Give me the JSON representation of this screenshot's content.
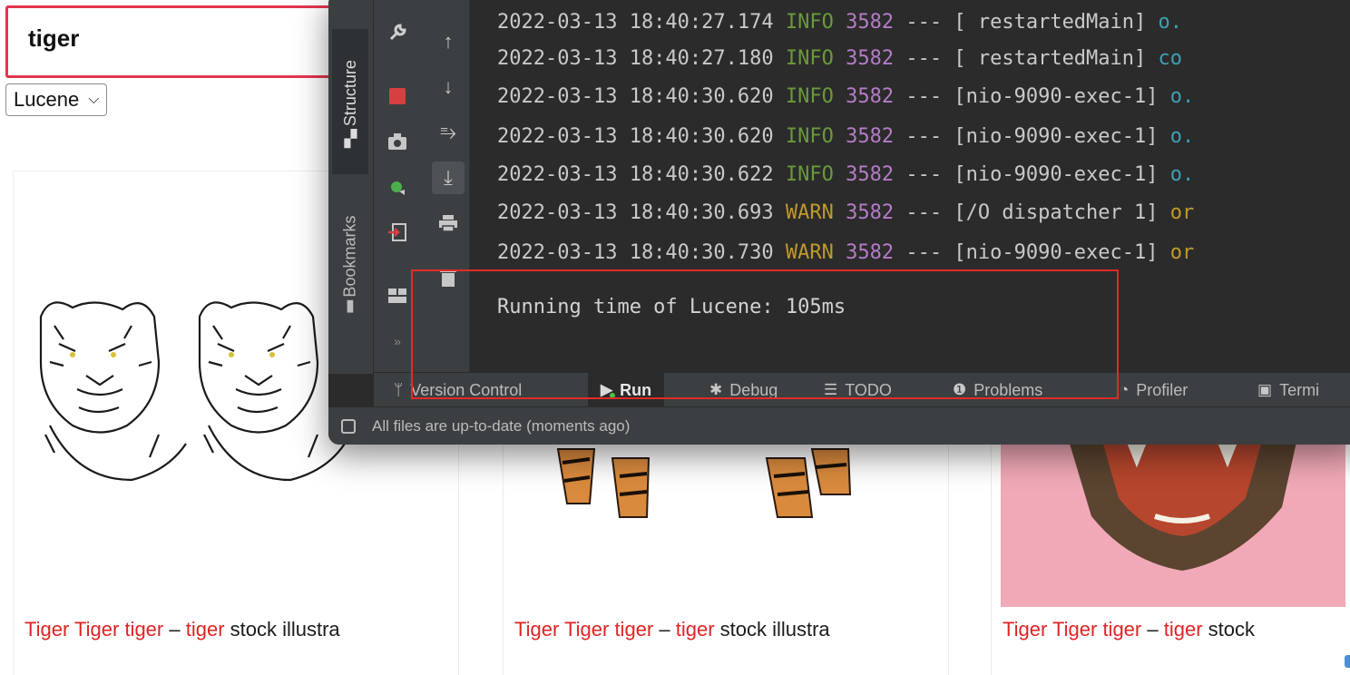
{
  "search": {
    "value": "tiger"
  },
  "engine_select": {
    "selected": "Lucene",
    "caret": "⌵"
  },
  "results": [
    {
      "title_parts": [
        {
          "text": "Tiger Tiger tiger",
          "hl": true
        },
        {
          "text": " – ",
          "hl": false
        },
        {
          "text": "tiger",
          "hl": true
        },
        {
          "text": " stock illustra",
          "hl": false
        }
      ]
    },
    {
      "title_parts": [
        {
          "text": "Tiger Tiger tiger",
          "hl": true
        },
        {
          "text": " – ",
          "hl": false
        },
        {
          "text": "tiger",
          "hl": true
        },
        {
          "text": " stock illustra",
          "hl": false
        }
      ]
    },
    {
      "title_parts": [
        {
          "text": "Tiger Tiger tiger",
          "hl": true
        },
        {
          "text": " – ",
          "hl": false
        },
        {
          "text": "tiger",
          "hl": true
        },
        {
          "text": " stock",
          "hl": false
        }
      ]
    }
  ],
  "ide": {
    "side_tabs": {
      "structure": "Structure",
      "bookmarks": "Bookmarks"
    },
    "log_lines": [
      {
        "ts": "2022-03-13 18:40:27.174",
        "level": "INFO",
        "pid": "3582",
        "sep": "---",
        "thread": "[  restartedMain]",
        "logger": "o."
      },
      {
        "ts": "2022-03-13 18:40:27.180",
        "level": "INFO",
        "pid": "3582",
        "sep": "---",
        "thread": "[  restartedMain]",
        "logger": "co"
      },
      {
        "ts": "2022-03-13 18:40:30.620",
        "level": "INFO",
        "pid": "3582",
        "sep": "---",
        "thread": "[nio-9090-exec-1]",
        "logger": "o."
      },
      {
        "ts": "2022-03-13 18:40:30.620",
        "level": "INFO",
        "pid": "3582",
        "sep": "---",
        "thread": "[nio-9090-exec-1]",
        "logger": "o."
      },
      {
        "ts": "2022-03-13 18:40:30.622",
        "level": "INFO",
        "pid": "3582",
        "sep": "---",
        "thread": "[nio-9090-exec-1]",
        "logger": "o."
      },
      {
        "ts": "2022-03-13 18:40:30.693",
        "level": "WARN",
        "pid": "3582",
        "sep": "---",
        "thread": "[/O dispatcher 1]",
        "logger": "or"
      },
      {
        "ts": "2022-03-13 18:40:30.730",
        "level": "WARN",
        "pid": "3582",
        "sep": "---",
        "thread": "[nio-9090-exec-1]",
        "logger": "or"
      }
    ],
    "runtime_message": "Running time of Lucene: 105ms",
    "tabs": {
      "version_control": "Version Control",
      "run": "Run",
      "debug": "Debug",
      "todo": "TODO",
      "problems": "Problems",
      "profiler": "Profiler",
      "terminal": "Termi"
    },
    "status": "All files are up-to-date (moments ago)",
    "colors": {
      "info": "#6a9a3a",
      "warn": "#bf9a2b",
      "pid": "#b57cc7",
      "highlight": "#e02a2a"
    }
  }
}
